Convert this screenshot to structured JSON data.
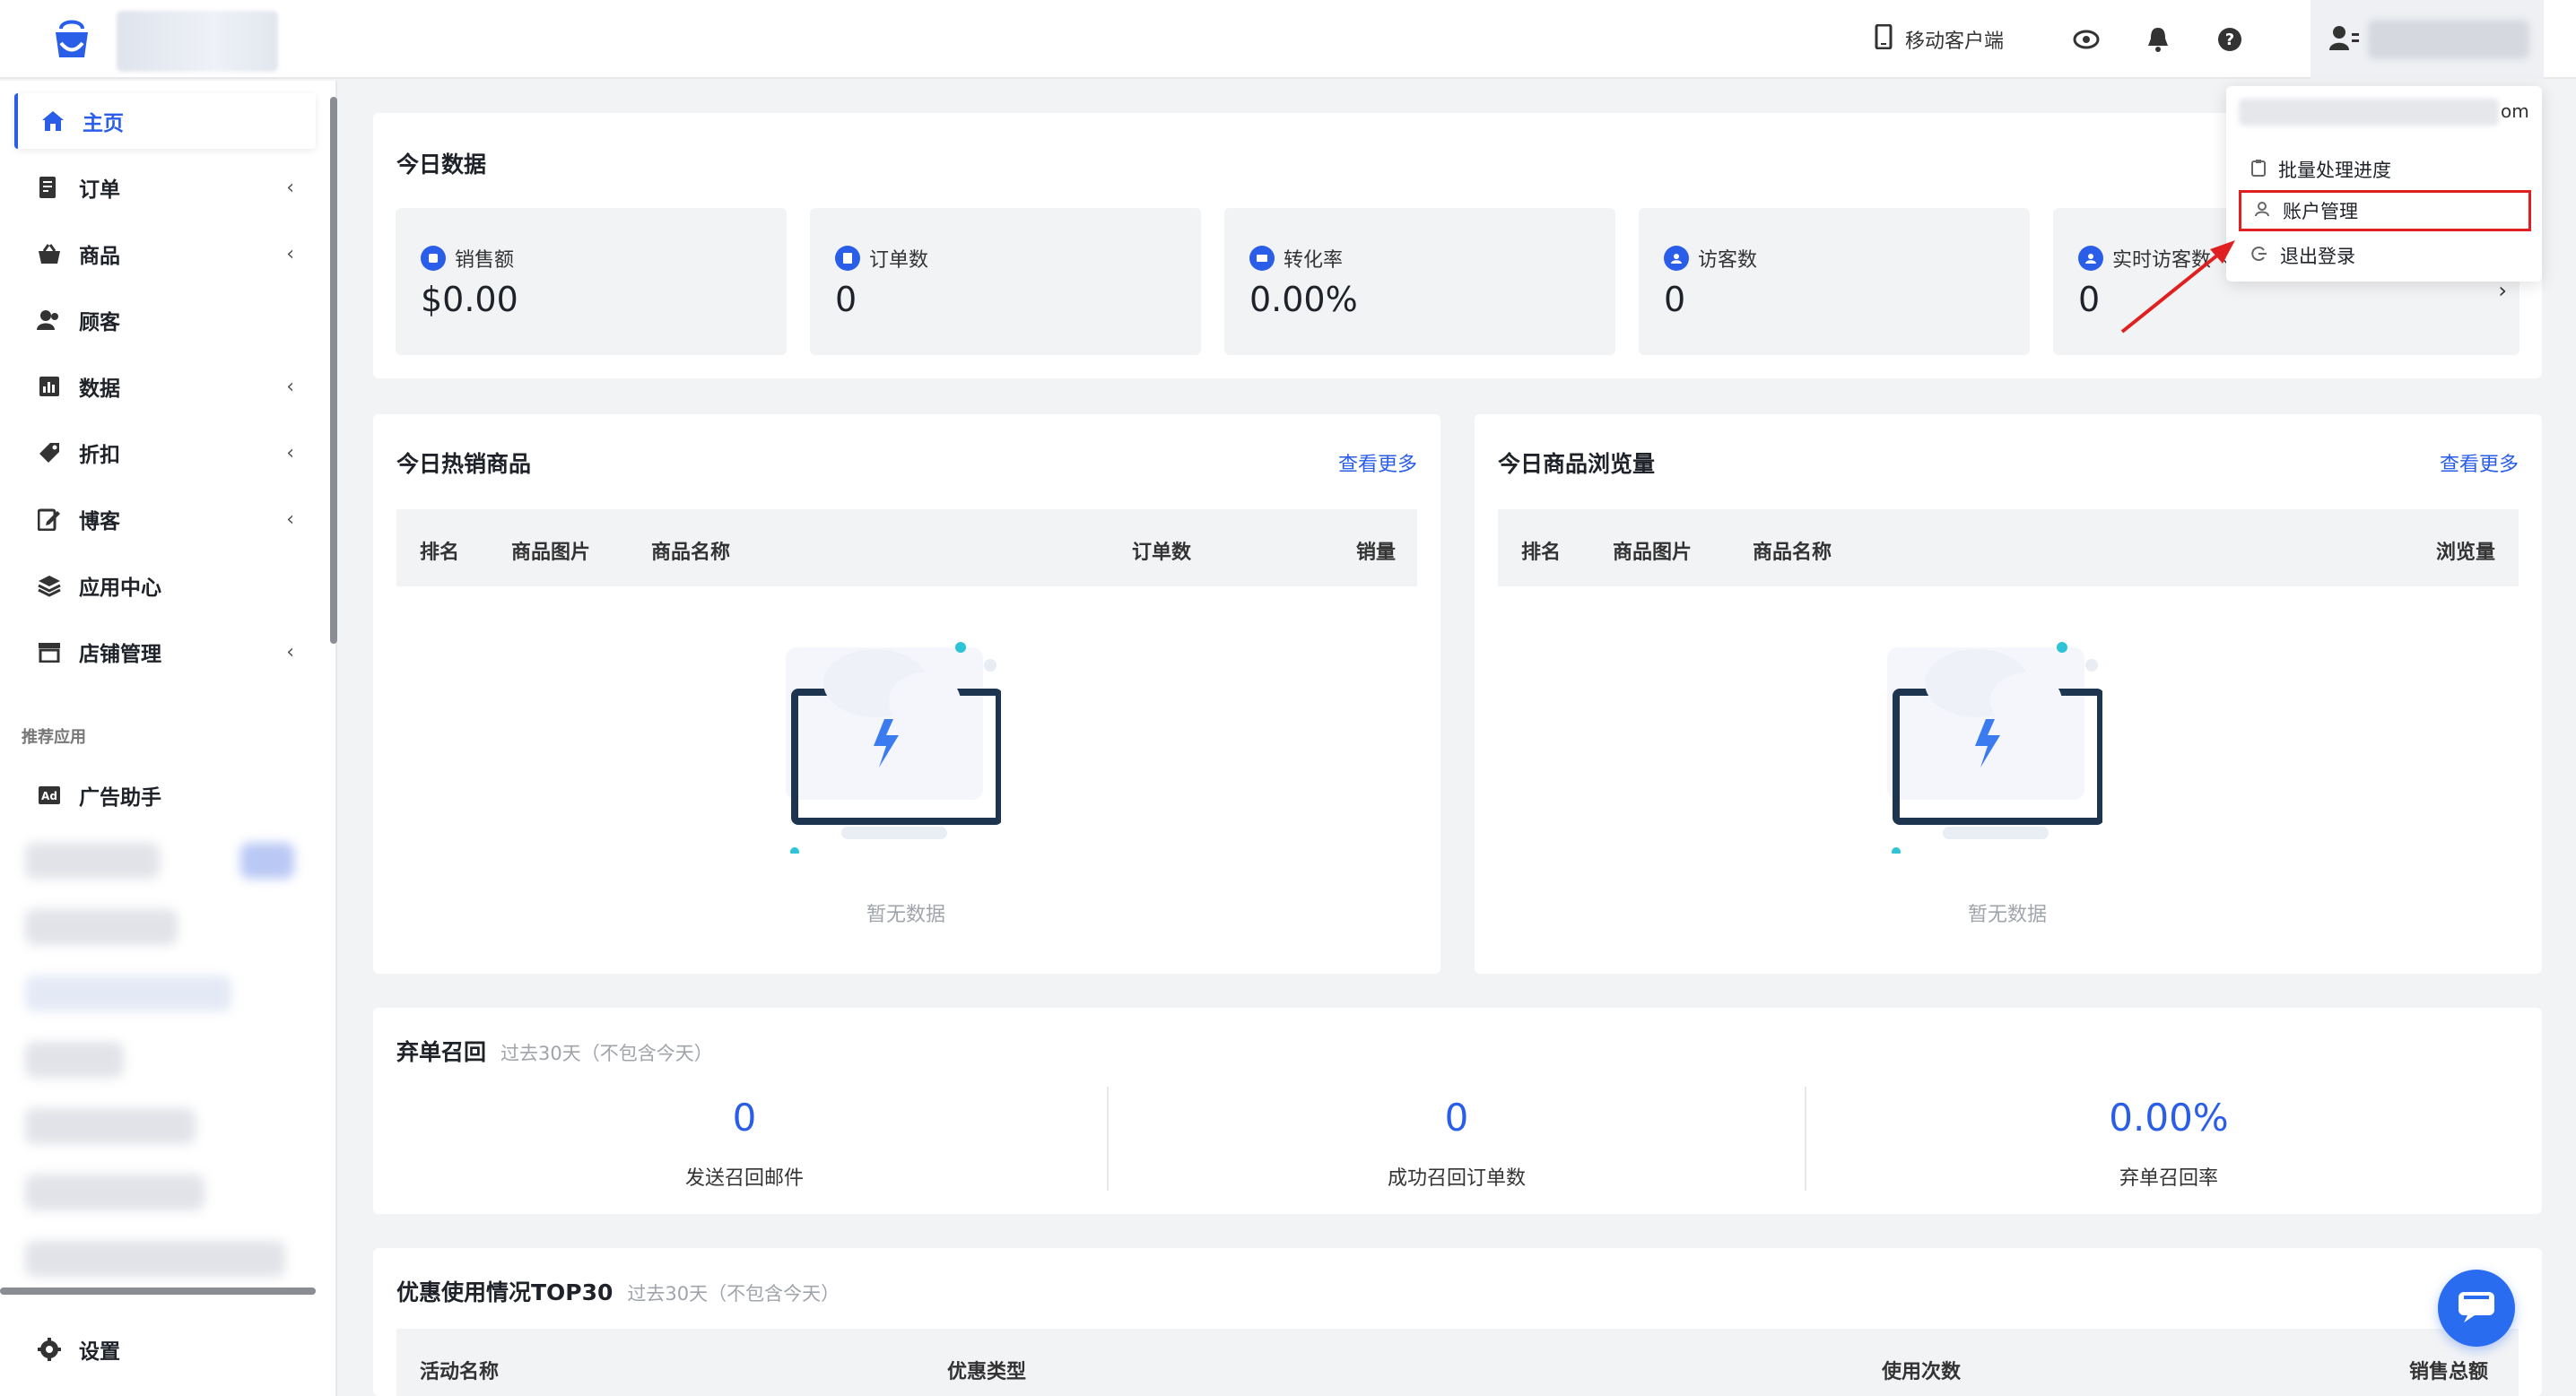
{
  "header": {
    "mobile_label": "移动客户端"
  },
  "sidebar": {
    "items": [
      {
        "label": "主页"
      },
      {
        "label": "订单"
      },
      {
        "label": "商品"
      },
      {
        "label": "顾客"
      },
      {
        "label": "数据"
      },
      {
        "label": "折扣"
      },
      {
        "label": "博客"
      },
      {
        "label": "应用中心"
      },
      {
        "label": "店铺管理"
      }
    ],
    "section_title": "推荐应用",
    "recommended": [
      {
        "label": "广告助手"
      }
    ],
    "settings_label": "设置"
  },
  "today": {
    "title": "今日数据",
    "stats": [
      {
        "label": "销售额",
        "value": "$0.00"
      },
      {
        "label": "订单数",
        "value": "0"
      },
      {
        "label": "转化率",
        "value": "0.00%"
      },
      {
        "label": "访客数",
        "value": "0"
      },
      {
        "label": "实时访客数",
        "value": "0"
      }
    ]
  },
  "hot_products": {
    "title": "今日热销商品",
    "more": "查看更多",
    "columns": [
      "排名",
      "商品图片",
      "商品名称",
      "订单数",
      "销量"
    ],
    "empty": "暂无数据"
  },
  "views": {
    "title": "今日商品浏览量",
    "more": "查看更多",
    "columns": [
      "排名",
      "商品图片",
      "商品名称",
      "浏览量"
    ],
    "empty": "暂无数据"
  },
  "abandon": {
    "title": "弃单召回",
    "subtitle": "过去30天（不包含今天）",
    "metrics": [
      {
        "value": "0",
        "label": "发送召回邮件"
      },
      {
        "value": "0",
        "label": "成功召回订单数"
      },
      {
        "value": "0.00%",
        "label": "弃单召回率"
      }
    ]
  },
  "coupons": {
    "title": "优惠使用情况TOP30",
    "subtitle": "过去30天（不包含今天）",
    "columns": [
      "活动名称",
      "优惠类型",
      "使用次数",
      "销售总额"
    ]
  },
  "dropdown": {
    "email_tail": "om",
    "items": [
      {
        "label": "批量处理进度"
      },
      {
        "label": "账户管理"
      },
      {
        "label": "退出登录"
      }
    ]
  },
  "colors": {
    "accent": "#2a5ee8",
    "highlight": "#e02020"
  }
}
